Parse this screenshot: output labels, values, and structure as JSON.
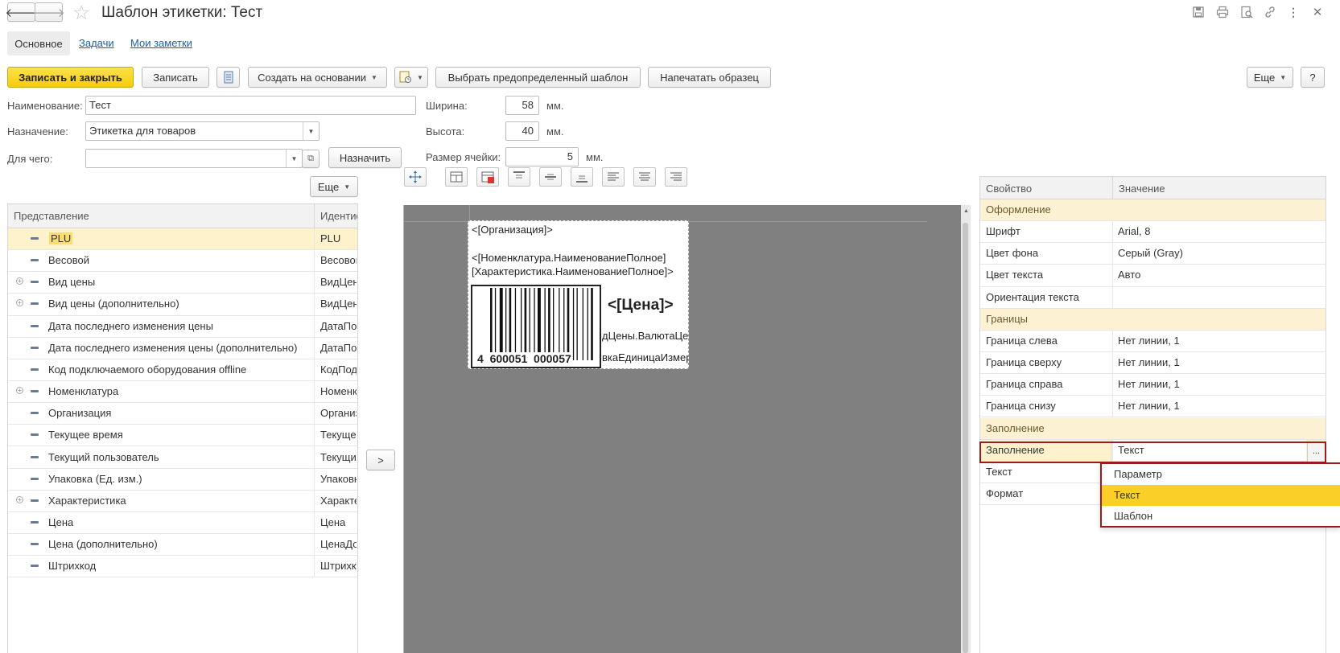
{
  "window": {
    "title": "Шаблон этикетки: Тест",
    "nav_back": "🡐",
    "nav_forward": "🡒",
    "star": "☆",
    "icons": [
      "save-icon",
      "print-icon",
      "preview-icon",
      "link-icon",
      "more-icon",
      "close-icon"
    ]
  },
  "tabs": [
    {
      "label": "Основное",
      "active": true
    },
    {
      "label": "Задачи",
      "active": false
    },
    {
      "label": "Мои заметки",
      "active": false
    }
  ],
  "toolbar": {
    "save_close": "Записать и закрыть",
    "save": "Записать",
    "create_based": "Создать на основании",
    "choose_template": "Выбрать предопределенный шаблон",
    "print_sample": "Напечатать образец",
    "more": "Еще",
    "help": "?"
  },
  "form": {
    "name_label": "Наименование:",
    "name_value": "Тест",
    "purpose_label": "Назначение:",
    "purpose_value": "Этикетка для товаров",
    "for_label": "Для чего:",
    "for_value": "",
    "assign_button": "Назначить",
    "width_label": "Ширина:",
    "width_value": "58",
    "height_label": "Высота:",
    "height_value": "40",
    "cell_label": "Размер ячейки:",
    "cell_value": "5",
    "unit": "мм."
  },
  "left_panel": {
    "more": "Еще",
    "col1": "Представление",
    "col2": "Идентификатор",
    "rows": [
      {
        "name": "PLU",
        "id": "PLU",
        "expandable": false,
        "selected": true
      },
      {
        "name": "Весовой",
        "id": "Весовой",
        "expandable": false
      },
      {
        "name": "Вид цены",
        "id": "ВидЦены",
        "expandable": true
      },
      {
        "name": "Вид цены (дополнительно)",
        "id": "ВидЦены",
        "expandable": true
      },
      {
        "name": "Дата последнего изменения цены",
        "id": "ДатаПо",
        "expandable": false
      },
      {
        "name": "Дата последнего изменения цены (дополнительно)",
        "id": "ДатаПо",
        "expandable": false
      },
      {
        "name": "Код подключаемого оборудования offline",
        "id": "КодПод",
        "expandable": false
      },
      {
        "name": "Номенклатура",
        "id": "Номенк",
        "expandable": true
      },
      {
        "name": "Организация",
        "id": "Организ",
        "expandable": false
      },
      {
        "name": "Текущее время",
        "id": "Текуще",
        "expandable": false
      },
      {
        "name": "Текущий пользователь",
        "id": "Текущи",
        "expandable": false
      },
      {
        "name": "Упаковка (Ед. изм.)",
        "id": "Упаковк",
        "expandable": false
      },
      {
        "name": "Характеристика",
        "id": "Характе",
        "expandable": true
      },
      {
        "name": "Цена",
        "id": "Цена",
        "expandable": false
      },
      {
        "name": "Цена (дополнительно)",
        "id": "ЦенаДо",
        "expandable": false
      },
      {
        "name": "Штрихкод",
        "id": "Штрихк",
        "expandable": false
      }
    ]
  },
  "transfer_button": ">",
  "label_preview": {
    "org": "<[Организация]>",
    "nomen_line1": "<[Номенклатура.НаименованиеПолное]",
    "nomen_line2": "[Характеристика.НаименованиеПолное]>",
    "price": "<[Цена]>",
    "currency": "дЦены.ВалютаЦе",
    "unit": "вкаЕдиницаИзмер",
    "barcode_digits": "4  600051  000057"
  },
  "properties": {
    "col1": "Свойство",
    "col2": "Значение",
    "rows": [
      {
        "group": true,
        "key": "Оформление",
        "value": ""
      },
      {
        "key": "Шрифт",
        "value": "Arial, 8"
      },
      {
        "key": "Цвет фона",
        "value": "Серый (Gray)"
      },
      {
        "key": "Цвет текста",
        "value": "Авто"
      },
      {
        "key": "Ориентация текста",
        "value": ""
      },
      {
        "group": true,
        "key": "Границы",
        "value": ""
      },
      {
        "key": "Граница слева",
        "value": "Нет линии, 1"
      },
      {
        "key": "Граница сверху",
        "value": "Нет линии, 1"
      },
      {
        "key": "Граница справа",
        "value": "Нет линии, 1"
      },
      {
        "key": "Граница снизу",
        "value": "Нет линии, 1"
      },
      {
        "group": true,
        "key": "Заполнение",
        "value": ""
      },
      {
        "key": "Заполнение",
        "value": "Текст",
        "active": true
      },
      {
        "key": "Текст",
        "value": ""
      },
      {
        "key": "Формат",
        "value": ""
      }
    ],
    "ellipsis": "..."
  },
  "dropdown": {
    "options": [
      {
        "label": "Параметр",
        "selected": false
      },
      {
        "label": "Текст",
        "selected": true
      },
      {
        "label": "Шаблон",
        "selected": false
      }
    ]
  },
  "colors": {
    "accent": "#f4cc0e",
    "group_bg": "#fcf1d2",
    "active_border": "#9c1b1b",
    "canvas_bg": "#808080"
  }
}
